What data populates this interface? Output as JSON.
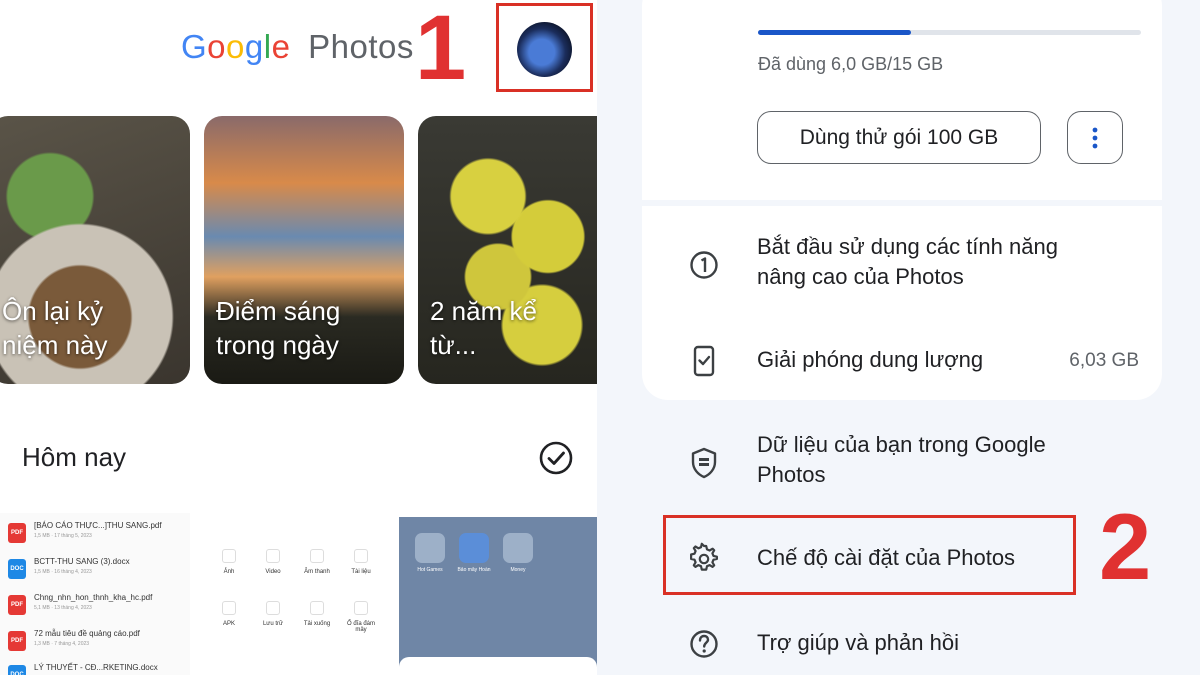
{
  "left": {
    "app_title_google": "Google",
    "app_title_photos": "Photos",
    "step_marker": "1",
    "memories": [
      {
        "line1": "Ôn lại kỷ",
        "line2": "niệm này"
      },
      {
        "line1": "Điểm sáng",
        "line2": "trong ngày"
      },
      {
        "line1": "2 năm kể",
        "line2": "từ..."
      }
    ],
    "section_title": "Hôm nay",
    "docs": [
      {
        "type": "PDF",
        "name": "[BÁO CÁO THỰC...]THU SANG.pdf",
        "sub": "1,5 MB · 17 tháng 5, 2023",
        "color": "#e53935"
      },
      {
        "type": "DOC",
        "name": "BCTT-THU SANG (3).docx",
        "sub": "1,5 MB · 16 tháng 4, 2023",
        "color": "#1e88e5"
      },
      {
        "type": "PDF",
        "name": "Chng_nhn_hon_thnh_kha_hc.pdf",
        "sub": "5,1 MB · 13 tháng 4, 2023",
        "color": "#e53935"
      },
      {
        "type": "PDF",
        "name": "72 mẫu tiêu đề quảng cáo.pdf",
        "sub": "1,3 MB · 7 tháng 4, 2023",
        "color": "#e53935"
      },
      {
        "type": "DOC",
        "name": "LÝ THUYẾT - CĐ...RKETING.docx",
        "sub": "",
        "color": "#1e88e5"
      }
    ],
    "categories": [
      "Ảnh",
      "Video",
      "Âm thanh",
      "Tài liệu",
      "APK",
      "Lưu trữ",
      "Tải xuống",
      "Ổ đĩa đám mây"
    ],
    "desktop_apps": [
      "Hot Games",
      "Bảo mây Hoàn",
      "Money"
    ]
  },
  "right": {
    "storage_used": "Đã dùng 6,0 GB/15 GB",
    "storage_fraction": 0.4,
    "trial_button": "Dùng thử gói 100 GB",
    "menu": [
      {
        "icon": "one-circle-icon",
        "line1": "Bắt đầu sử dụng các tính năng",
        "line2": "nâng cao của Photos",
        "value": ""
      },
      {
        "icon": "phone-check-icon",
        "line1": "Giải phóng dung lượng",
        "line2": "",
        "value": "6,03 GB"
      },
      {
        "icon": "shield-data-icon",
        "line1": "Dữ liệu của bạn trong Google",
        "line2": "Photos",
        "value": ""
      },
      {
        "icon": "gear-icon",
        "line1": "Chế độ cài đặt của Photos",
        "line2": "",
        "value": ""
      },
      {
        "icon": "help-icon",
        "line1": "Trợ giúp và phản hồi",
        "line2": "",
        "value": ""
      }
    ],
    "step_marker": "2"
  },
  "colors": {
    "accent_red": "#d93025",
    "blue": "#1a56c8"
  }
}
